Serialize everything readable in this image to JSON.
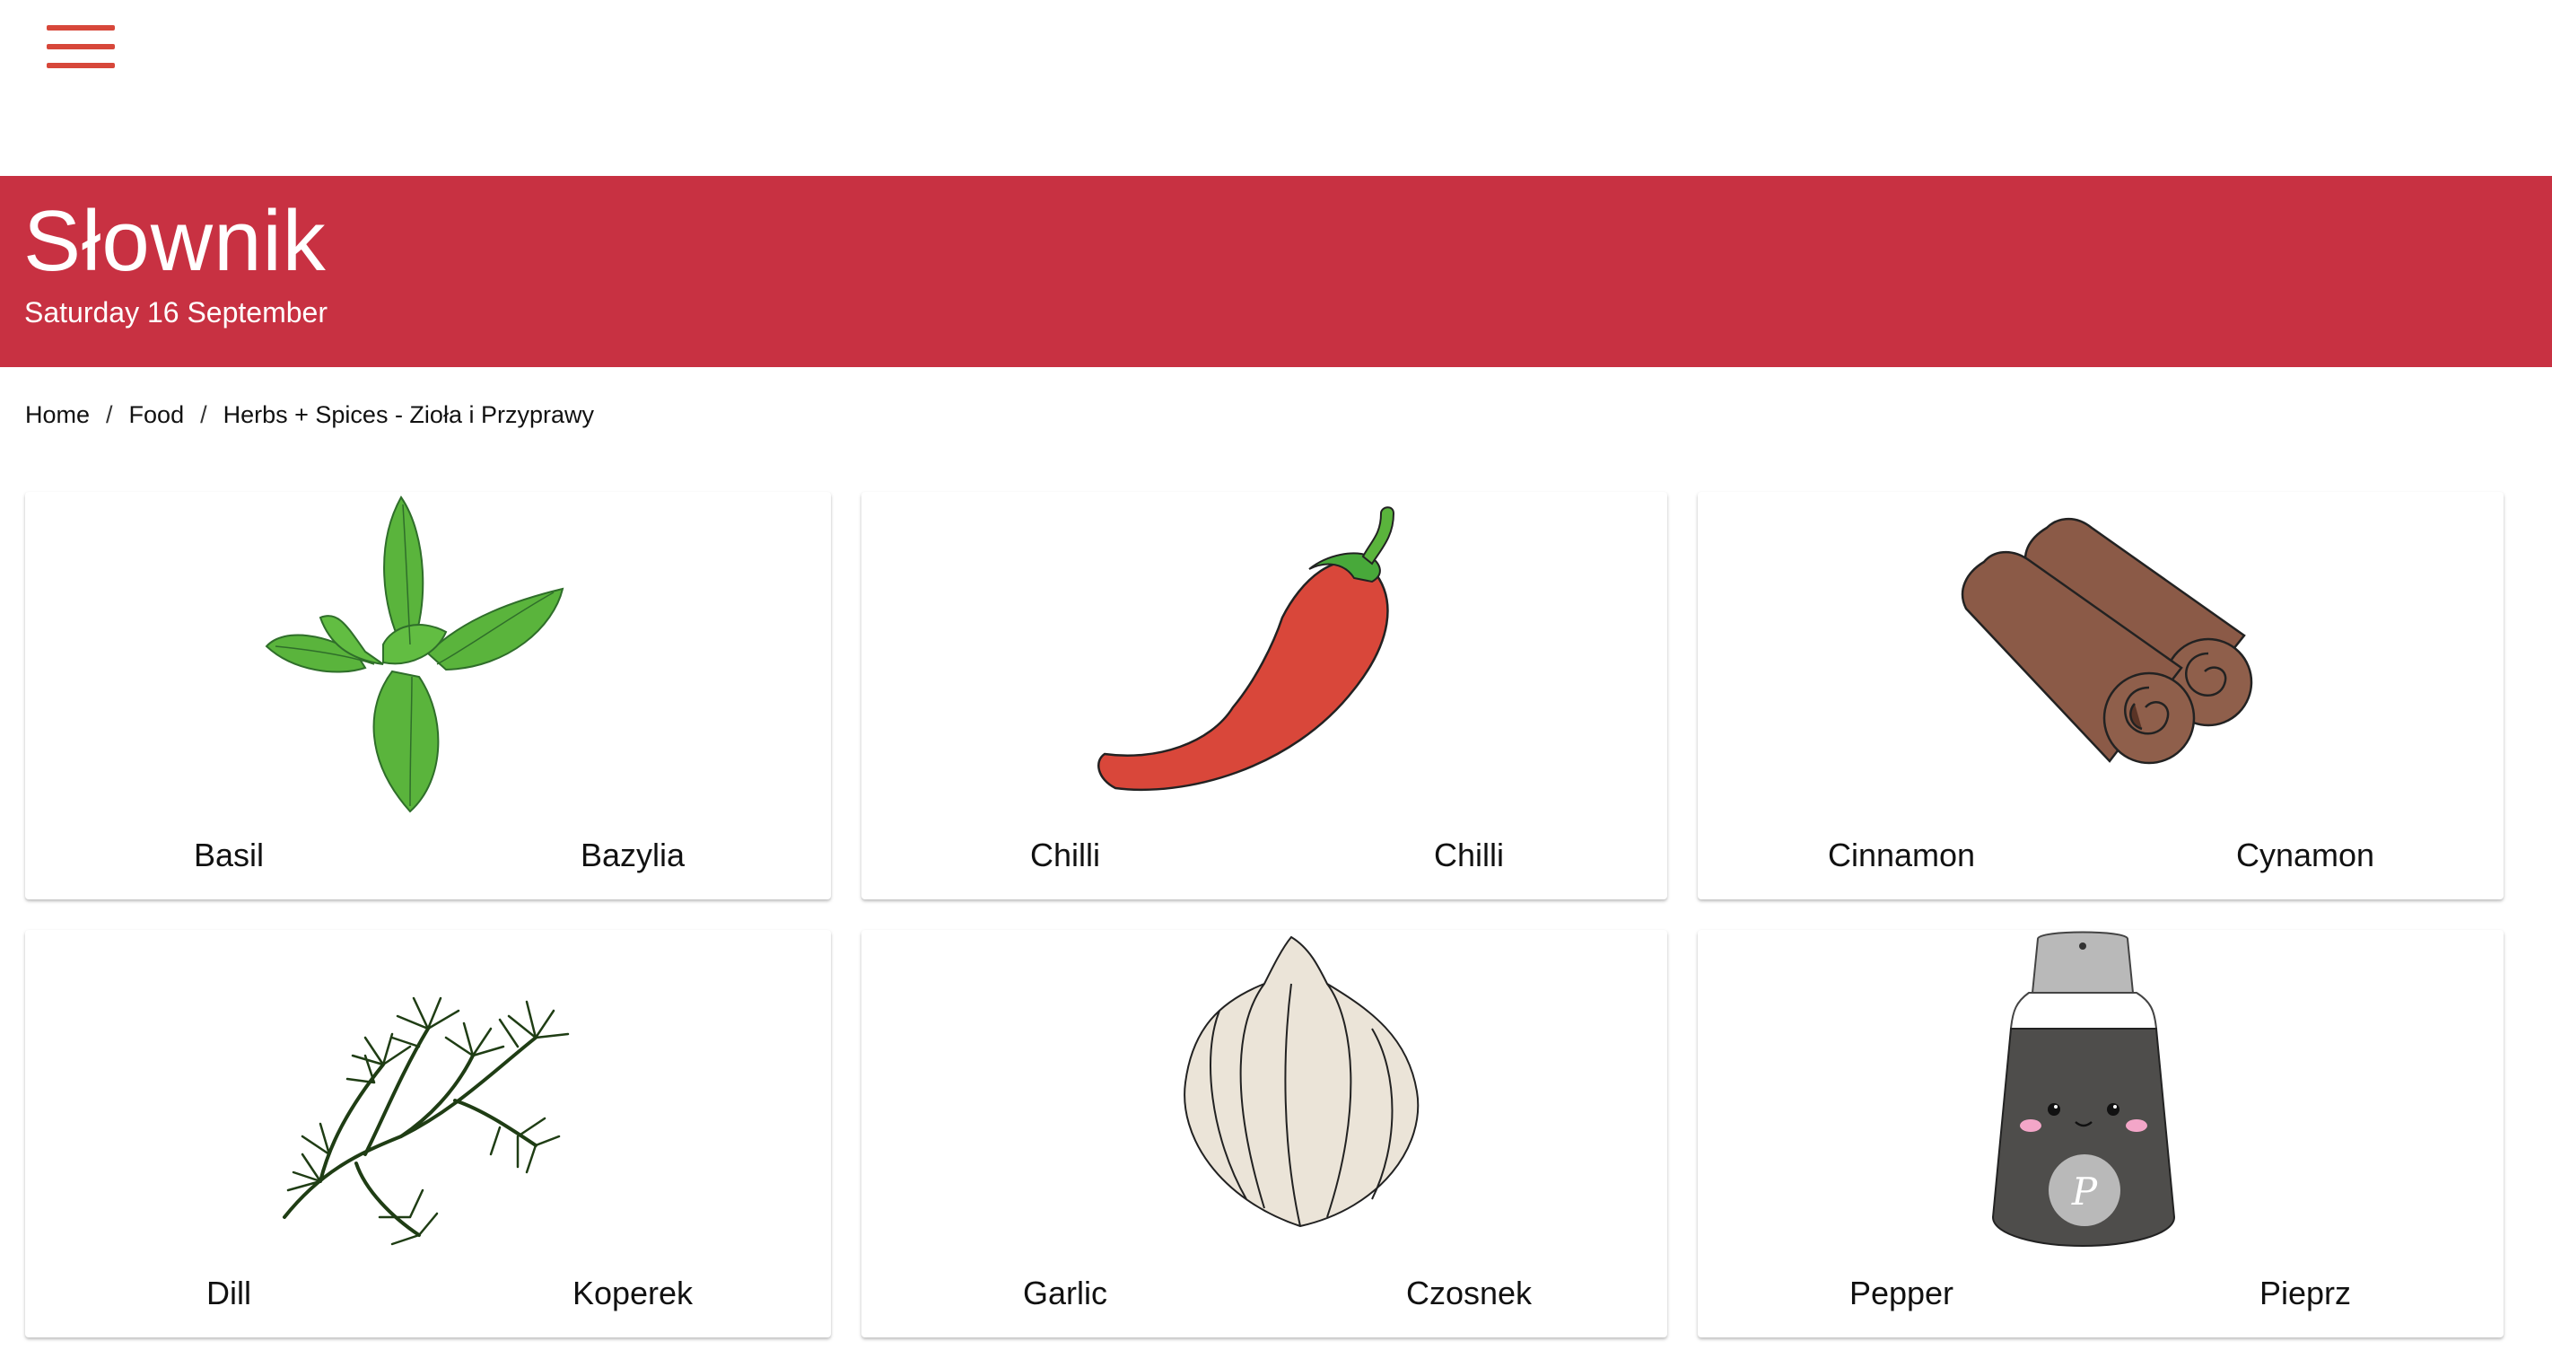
{
  "header": {
    "menu_icon": "hamburger-menu-icon",
    "accent_color": "#d7473a"
  },
  "banner": {
    "title": "Słownik",
    "date": "Saturday 16 September",
    "color": "#c83142"
  },
  "breadcrumb": {
    "items": [
      "Home",
      "Food",
      "Herbs + Spices - Zioła i Przyprawy"
    ],
    "separator": "/"
  },
  "cards": [
    {
      "icon": "basil-icon",
      "en": "Basil",
      "pl": "Bazylia"
    },
    {
      "icon": "chilli-icon",
      "en": "Chilli",
      "pl": "Chilli"
    },
    {
      "icon": "cinnamon-icon",
      "en": "Cinnamon",
      "pl": "Cynamon"
    },
    {
      "icon": "dill-icon",
      "en": "Dill",
      "pl": "Koperek"
    },
    {
      "icon": "garlic-icon",
      "en": "Garlic",
      "pl": "Czosnek"
    },
    {
      "icon": "pepper-icon",
      "en": "Pepper",
      "pl": "Pieprz",
      "badge": "P"
    }
  ]
}
